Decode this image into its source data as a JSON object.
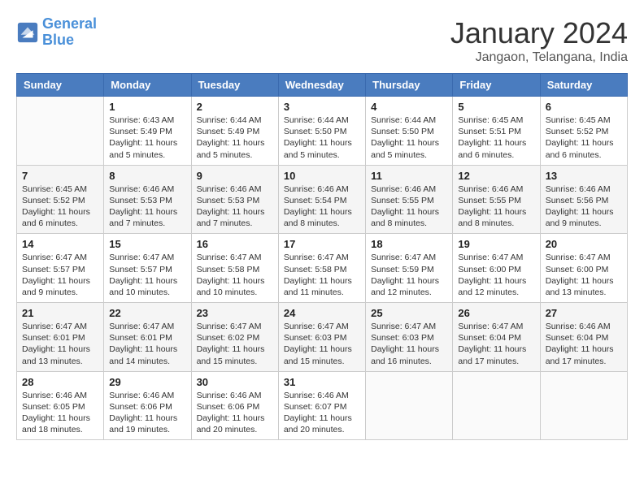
{
  "header": {
    "logo_line1": "General",
    "logo_line2": "Blue",
    "title": "January 2024",
    "subtitle": "Jangaon, Telangana, India"
  },
  "columns": [
    "Sunday",
    "Monday",
    "Tuesday",
    "Wednesday",
    "Thursday",
    "Friday",
    "Saturday"
  ],
  "weeks": [
    [
      {
        "day": "",
        "info": ""
      },
      {
        "day": "1",
        "info": "Sunrise: 6:43 AM\nSunset: 5:49 PM\nDaylight: 11 hours\nand 5 minutes."
      },
      {
        "day": "2",
        "info": "Sunrise: 6:44 AM\nSunset: 5:49 PM\nDaylight: 11 hours\nand 5 minutes."
      },
      {
        "day": "3",
        "info": "Sunrise: 6:44 AM\nSunset: 5:50 PM\nDaylight: 11 hours\nand 5 minutes."
      },
      {
        "day": "4",
        "info": "Sunrise: 6:44 AM\nSunset: 5:50 PM\nDaylight: 11 hours\nand 5 minutes."
      },
      {
        "day": "5",
        "info": "Sunrise: 6:45 AM\nSunset: 5:51 PM\nDaylight: 11 hours\nand 6 minutes."
      },
      {
        "day": "6",
        "info": "Sunrise: 6:45 AM\nSunset: 5:52 PM\nDaylight: 11 hours\nand 6 minutes."
      }
    ],
    [
      {
        "day": "7",
        "info": "Sunrise: 6:45 AM\nSunset: 5:52 PM\nDaylight: 11 hours\nand 6 minutes."
      },
      {
        "day": "8",
        "info": "Sunrise: 6:46 AM\nSunset: 5:53 PM\nDaylight: 11 hours\nand 7 minutes."
      },
      {
        "day": "9",
        "info": "Sunrise: 6:46 AM\nSunset: 5:53 PM\nDaylight: 11 hours\nand 7 minutes."
      },
      {
        "day": "10",
        "info": "Sunrise: 6:46 AM\nSunset: 5:54 PM\nDaylight: 11 hours\nand 8 minutes."
      },
      {
        "day": "11",
        "info": "Sunrise: 6:46 AM\nSunset: 5:55 PM\nDaylight: 11 hours\nand 8 minutes."
      },
      {
        "day": "12",
        "info": "Sunrise: 6:46 AM\nSunset: 5:55 PM\nDaylight: 11 hours\nand 8 minutes."
      },
      {
        "day": "13",
        "info": "Sunrise: 6:46 AM\nSunset: 5:56 PM\nDaylight: 11 hours\nand 9 minutes."
      }
    ],
    [
      {
        "day": "14",
        "info": "Sunrise: 6:47 AM\nSunset: 5:57 PM\nDaylight: 11 hours\nand 9 minutes."
      },
      {
        "day": "15",
        "info": "Sunrise: 6:47 AM\nSunset: 5:57 PM\nDaylight: 11 hours\nand 10 minutes."
      },
      {
        "day": "16",
        "info": "Sunrise: 6:47 AM\nSunset: 5:58 PM\nDaylight: 11 hours\nand 10 minutes."
      },
      {
        "day": "17",
        "info": "Sunrise: 6:47 AM\nSunset: 5:58 PM\nDaylight: 11 hours\nand 11 minutes."
      },
      {
        "day": "18",
        "info": "Sunrise: 6:47 AM\nSunset: 5:59 PM\nDaylight: 11 hours\nand 12 minutes."
      },
      {
        "day": "19",
        "info": "Sunrise: 6:47 AM\nSunset: 6:00 PM\nDaylight: 11 hours\nand 12 minutes."
      },
      {
        "day": "20",
        "info": "Sunrise: 6:47 AM\nSunset: 6:00 PM\nDaylight: 11 hours\nand 13 minutes."
      }
    ],
    [
      {
        "day": "21",
        "info": "Sunrise: 6:47 AM\nSunset: 6:01 PM\nDaylight: 11 hours\nand 13 minutes."
      },
      {
        "day": "22",
        "info": "Sunrise: 6:47 AM\nSunset: 6:01 PM\nDaylight: 11 hours\nand 14 minutes."
      },
      {
        "day": "23",
        "info": "Sunrise: 6:47 AM\nSunset: 6:02 PM\nDaylight: 11 hours\nand 15 minutes."
      },
      {
        "day": "24",
        "info": "Sunrise: 6:47 AM\nSunset: 6:03 PM\nDaylight: 11 hours\nand 15 minutes."
      },
      {
        "day": "25",
        "info": "Sunrise: 6:47 AM\nSunset: 6:03 PM\nDaylight: 11 hours\nand 16 minutes."
      },
      {
        "day": "26",
        "info": "Sunrise: 6:47 AM\nSunset: 6:04 PM\nDaylight: 11 hours\nand 17 minutes."
      },
      {
        "day": "27",
        "info": "Sunrise: 6:46 AM\nSunset: 6:04 PM\nDaylight: 11 hours\nand 17 minutes."
      }
    ],
    [
      {
        "day": "28",
        "info": "Sunrise: 6:46 AM\nSunset: 6:05 PM\nDaylight: 11 hours\nand 18 minutes."
      },
      {
        "day": "29",
        "info": "Sunrise: 6:46 AM\nSunset: 6:06 PM\nDaylight: 11 hours\nand 19 minutes."
      },
      {
        "day": "30",
        "info": "Sunrise: 6:46 AM\nSunset: 6:06 PM\nDaylight: 11 hours\nand 20 minutes."
      },
      {
        "day": "31",
        "info": "Sunrise: 6:46 AM\nSunset: 6:07 PM\nDaylight: 11 hours\nand 20 minutes."
      },
      {
        "day": "",
        "info": ""
      },
      {
        "day": "",
        "info": ""
      },
      {
        "day": "",
        "info": ""
      }
    ]
  ]
}
